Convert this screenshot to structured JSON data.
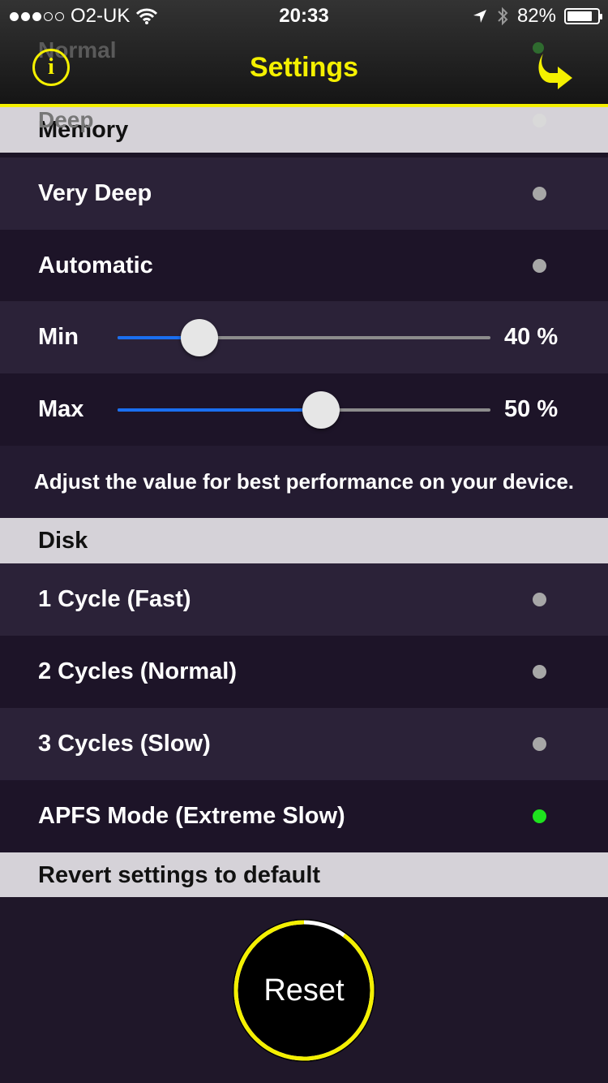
{
  "status": {
    "carrier": "O2-UK",
    "time": "20:33",
    "battery": "82%",
    "battery_level": 0.82,
    "signal_bars_filled": 3,
    "signal_bars_total": 5
  },
  "nav": {
    "title": "Settings",
    "ghost_text": "Normal",
    "info_label": "i"
  },
  "memory": {
    "header": "Memory",
    "ghost_item": "Deep",
    "items": [
      {
        "label": "Very Deep",
        "selected": false
      },
      {
        "label": "Automatic",
        "selected": false
      }
    ],
    "min_label": "Min",
    "min_value": "40 %",
    "min_fraction": 0.22,
    "max_label": "Max",
    "max_value": "50 %",
    "max_fraction": 0.545,
    "hint": "Adjust the value for best performance on your device."
  },
  "disk": {
    "header": "Disk",
    "items": [
      {
        "label": "1 Cycle (Fast)",
        "selected": false
      },
      {
        "label": "2 Cycles (Normal)",
        "selected": false
      },
      {
        "label": "3 Cycles (Slow)",
        "selected": false
      },
      {
        "label": "APFS Mode (Extreme Slow)",
        "selected": true
      }
    ]
  },
  "revert": {
    "header": "Revert settings to default",
    "button": "Reset",
    "ring_progress": 0.9
  },
  "colors": {
    "accent": "#f4f000",
    "selected_led": "#1ee31e",
    "unselected_led": "#a7a7a7",
    "slider_fill": "#1a6ff0"
  }
}
